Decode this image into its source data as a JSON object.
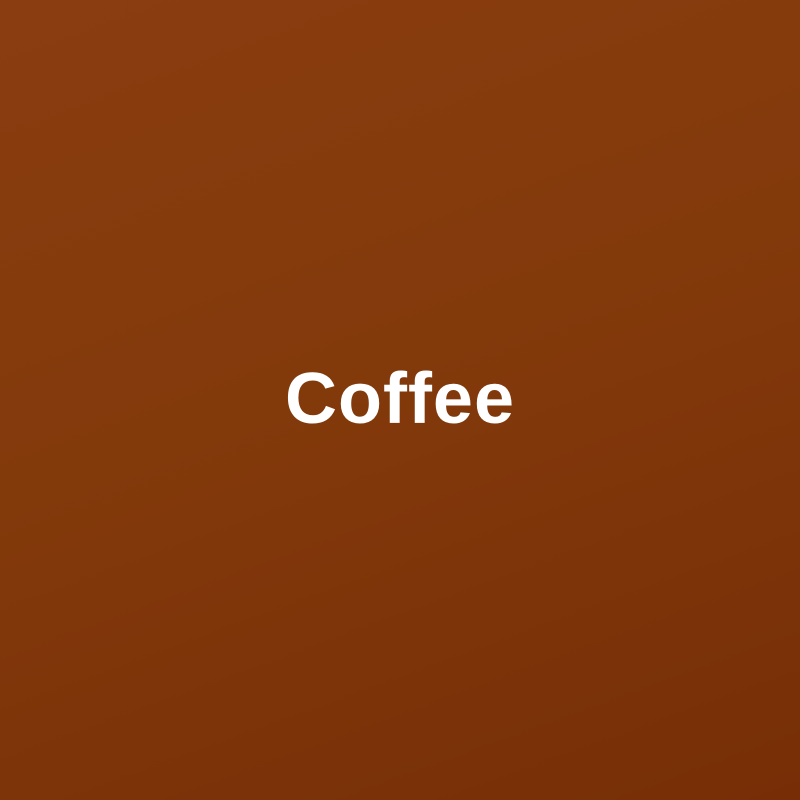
{
  "title": "Coffee",
  "colors": {
    "background_top": "#8a3d10",
    "background_bottom": "#772e06",
    "text": "#ffffff"
  }
}
